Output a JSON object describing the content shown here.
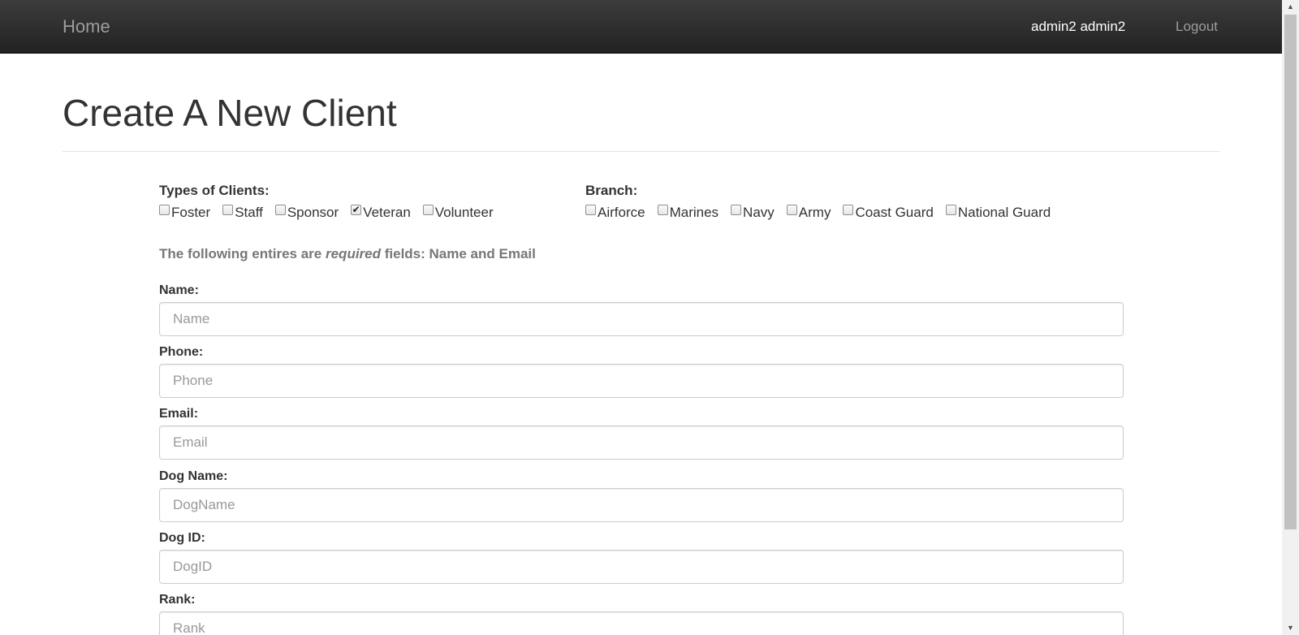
{
  "navbar": {
    "brand": "Home",
    "user": "admin2 admin2",
    "logout": "Logout"
  },
  "page": {
    "title": "Create A New Client"
  },
  "client_types": {
    "label": "Types of Clients:",
    "options": [
      {
        "label": "Foster",
        "checked": false
      },
      {
        "label": "Staff",
        "checked": false
      },
      {
        "label": "Sponsor",
        "checked": false
      },
      {
        "label": "Veteran",
        "checked": true
      },
      {
        "label": "Volunteer",
        "checked": false
      }
    ]
  },
  "branch": {
    "label": "Branch:",
    "options": [
      {
        "label": "Airforce",
        "checked": false
      },
      {
        "label": "Marines",
        "checked": false
      },
      {
        "label": "Navy",
        "checked": false
      },
      {
        "label": "Army",
        "checked": false
      },
      {
        "label": "Coast Guard",
        "checked": false
      },
      {
        "label": "National Guard",
        "checked": false
      }
    ]
  },
  "required_note": {
    "before": "The following entires are ",
    "emphasis": "required",
    "after": " fields: Name and Email"
  },
  "fields": {
    "name": {
      "label": "Name:",
      "placeholder": "Name",
      "value": ""
    },
    "phone": {
      "label": "Phone:",
      "placeholder": "Phone",
      "value": ""
    },
    "email": {
      "label": "Email:",
      "placeholder": "Email",
      "value": ""
    },
    "dog_name": {
      "label": "Dog Name:",
      "placeholder": "DogName",
      "value": ""
    },
    "dog_id": {
      "label": "Dog ID:",
      "placeholder": "DogID",
      "value": ""
    },
    "rank": {
      "label": "Rank:",
      "placeholder": "Rank",
      "value": ""
    }
  }
}
